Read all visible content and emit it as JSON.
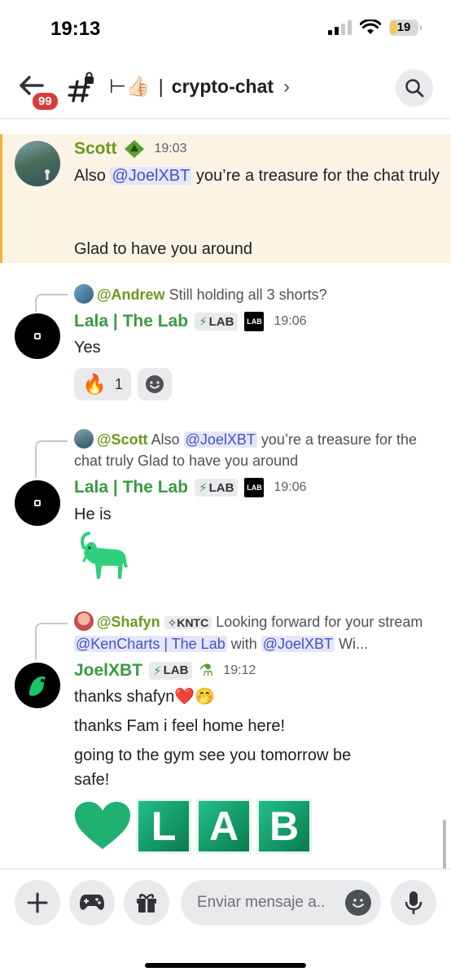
{
  "status_bar": {
    "time": "19:13",
    "battery": "19"
  },
  "header": {
    "badge_count": "99",
    "emoji": "⊢👍🏻",
    "separator": "|",
    "channel_name": "crypto-chat",
    "chevron": "›"
  },
  "messages": [
    {
      "author": "Scott",
      "time": "19:03",
      "text_before": "Also ",
      "mention": "@JoelXBT",
      "text_after": " you’re a treasure for the chat truly",
      "text_line2": "Glad to have you around"
    },
    {
      "reply_author": "@Andrew",
      "reply_text": "Still holding all 3 shorts?",
      "author": "Lala | The Lab",
      "role": "LAB",
      "logo": "LAB",
      "time": "19:06",
      "text": "Yes",
      "reaction_count": "1"
    },
    {
      "reply_author": "@Scott",
      "reply_before": "Also ",
      "reply_mention": "@JoelXBT",
      "reply_after": " you’re a treasure for the chat truly  Glad to have you around",
      "author": "Lala | The Lab",
      "role": "LAB",
      "logo": "LAB",
      "time": "19:06",
      "text": "He is",
      "emoji": "🐐"
    },
    {
      "reply_author": "@Shafyn",
      "reply_role": "KNTC",
      "reply_before": " Looking forward for your stream ",
      "reply_mention1": "@KenCharts | The Lab",
      "reply_mid": " with ",
      "reply_mention2": "@JoelXBT",
      "reply_after": "  Wi...",
      "author": "JoelXBT",
      "role": "LAB",
      "time": "19:12",
      "line1": "thanks shafyn❤️🤭",
      "line2": "thanks Fam i feel home here!",
      "line3": "going to the gym see you tomorrow be safe!",
      "tiles": [
        "L",
        "A",
        "B"
      ]
    }
  ],
  "composer": {
    "placeholder": "Enviar mensaje a.."
  },
  "colors": {
    "accent": "#3a9a3f",
    "mention": "#4752c4",
    "highlight": "#fbf3e4",
    "badge": "#d83c3e"
  },
  "icons": [
    "back-arrow-icon",
    "hash-lock-icon",
    "search-icon",
    "plus-icon",
    "gamepad-icon",
    "gift-icon",
    "emoji-icon",
    "mic-icon"
  ]
}
